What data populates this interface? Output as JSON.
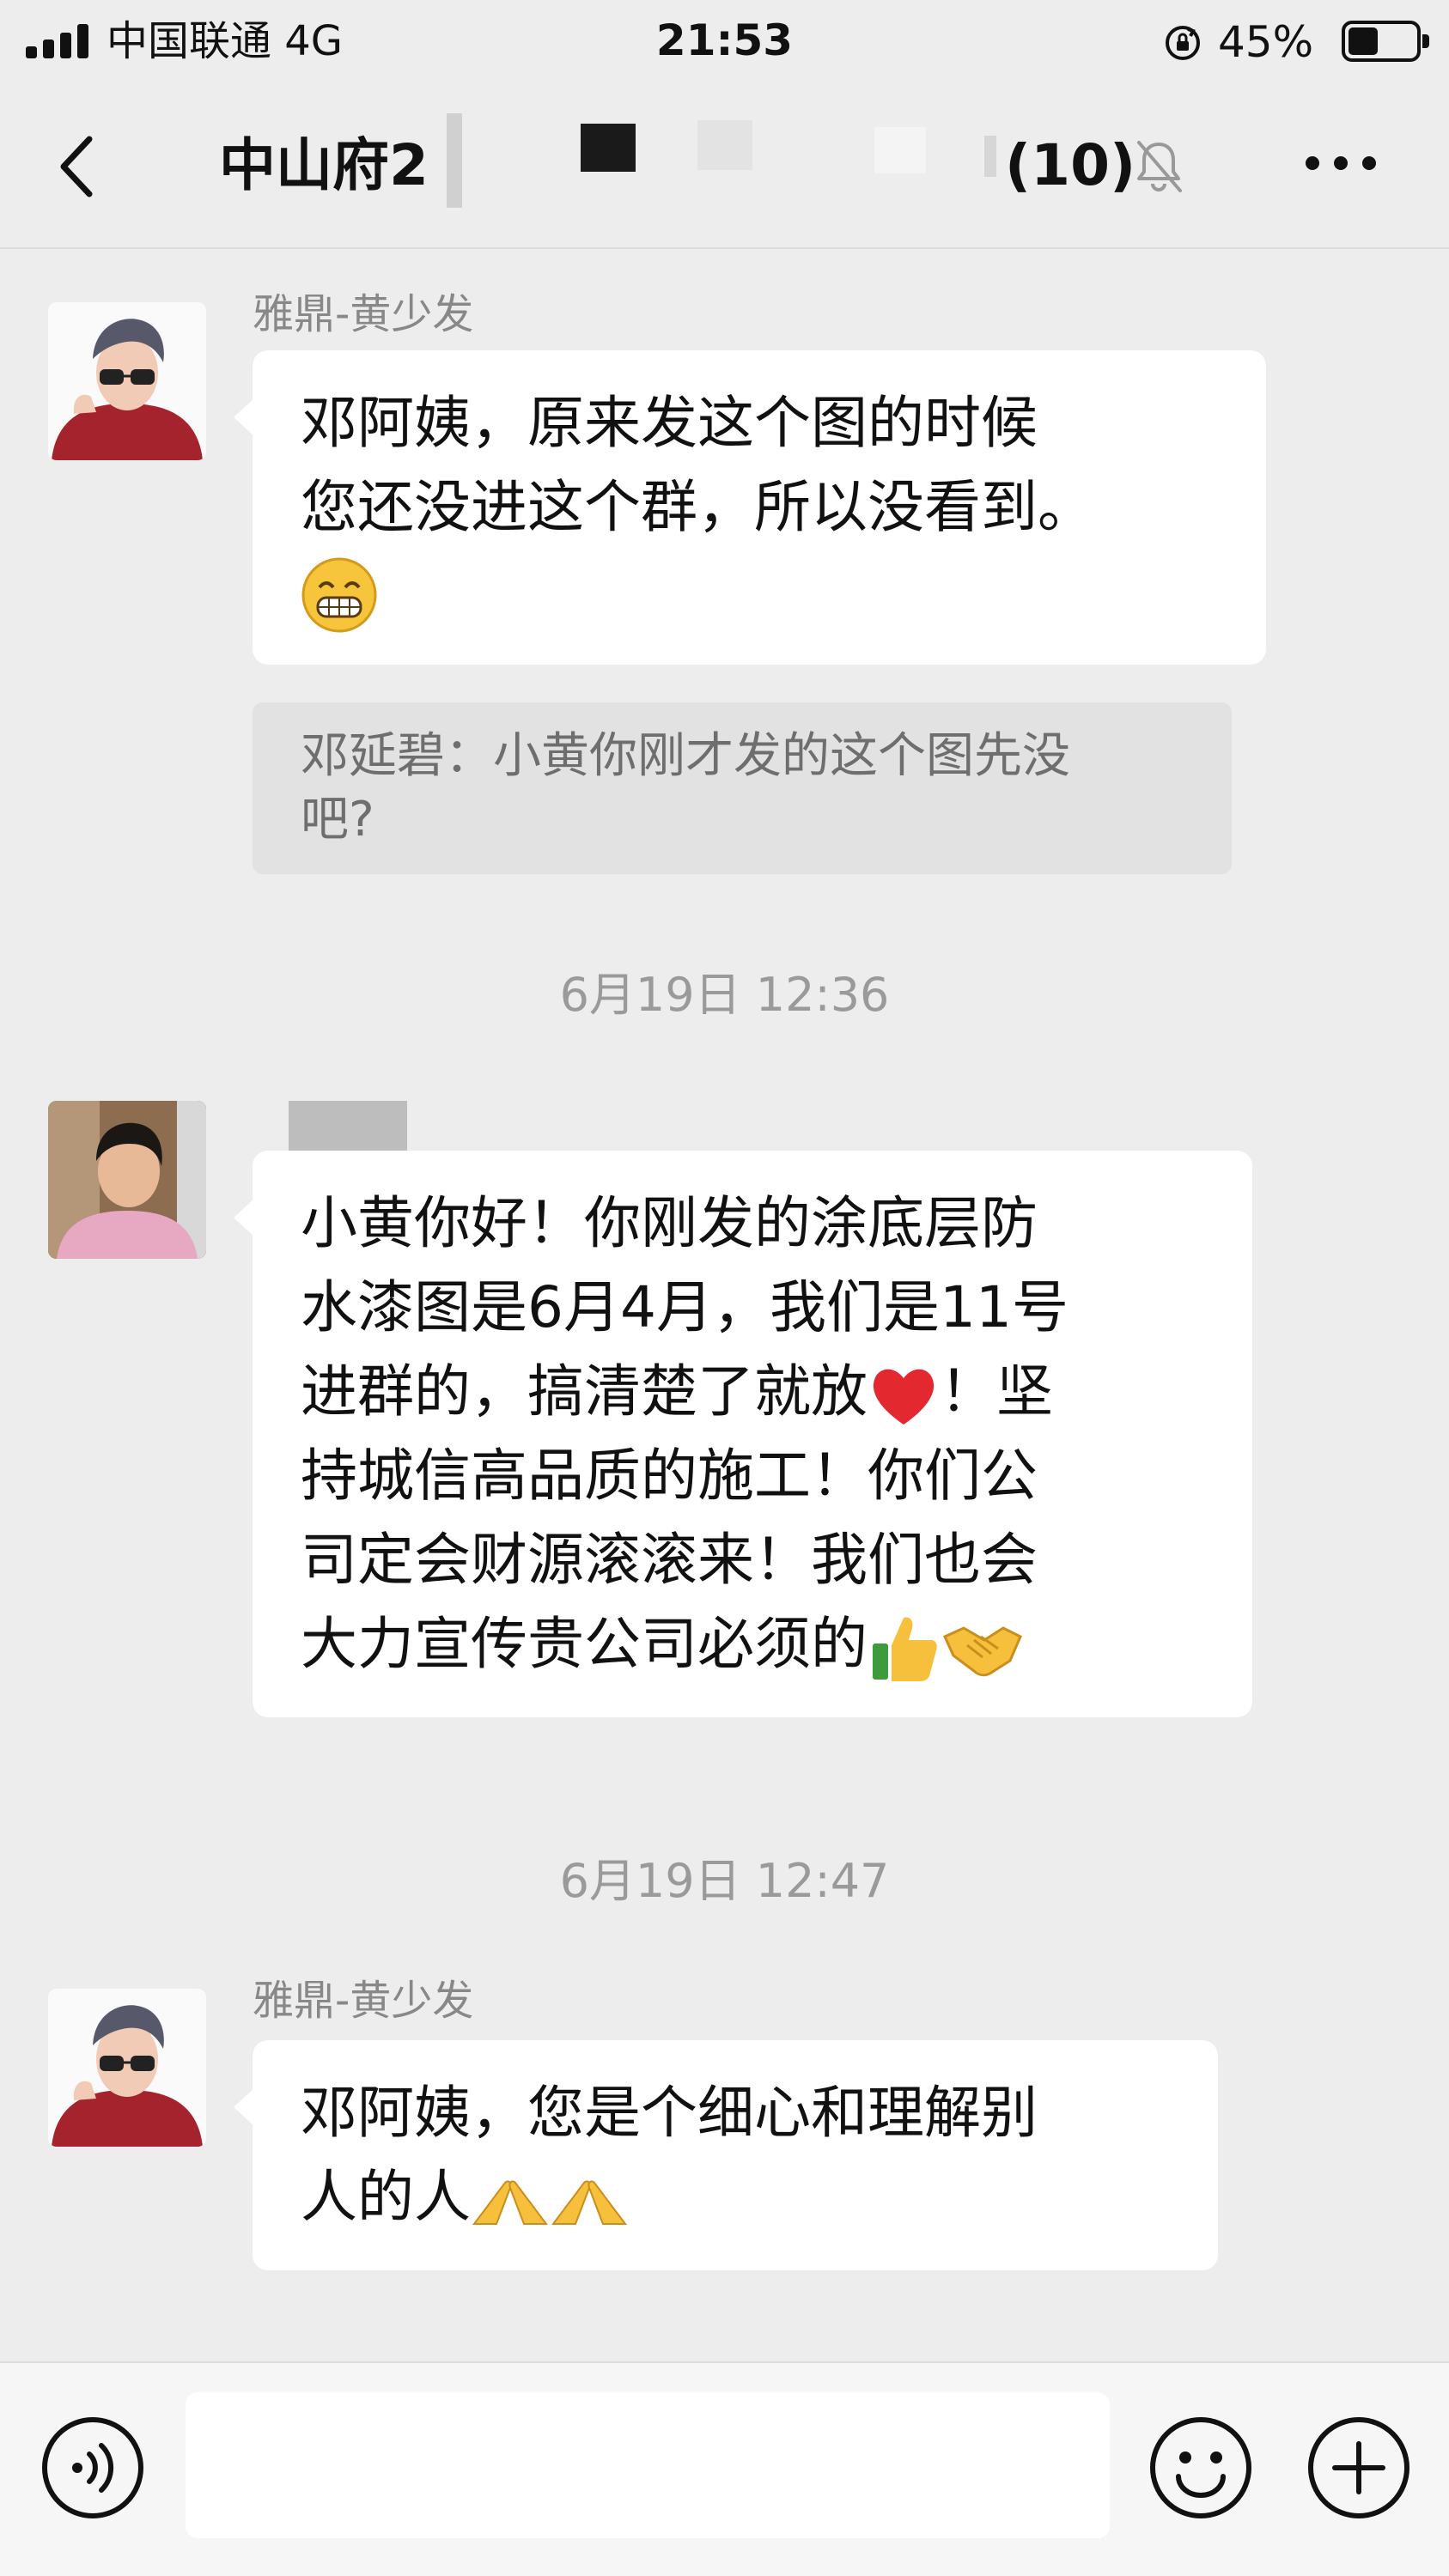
{
  "status_bar": {
    "carrier": "中国联通 4G",
    "time": "21:53",
    "battery_percent": "45%",
    "battery_level": 0.45
  },
  "nav": {
    "title_prefix": "中山府2",
    "member_count": "(10)",
    "back_icon": "chevron-left-icon",
    "mute_icon": "bell-off-icon",
    "more_icon": "ellipsis-icon"
  },
  "messages": [
    {
      "sender": "雅鼎-黄少发",
      "lines": [
        "邓阿姨，原来发这个图的时候",
        "您还没进这个群，所以没看到。"
      ],
      "emoji": "grinning-face",
      "quote_lines": [
        "邓延碧：小黄你刚才发的这个图先没",
        "吧?"
      ]
    },
    {
      "timestamp": "6月19日 12:36"
    },
    {
      "sender": "",
      "lines": [
        "小黄你好！你刚发的涂底层防",
        "水漆图是6月4月，我们是11号",
        "进群的，搞清楚了就放",
        "！坚",
        "持城信高品质的施工！你们公",
        "司定会财源滚滚来！我们也会",
        "大力宣传贵公司必须的"
      ]
    },
    {
      "timestamp": "6月19日 12:47"
    },
    {
      "sender": "雅鼎-黄少发",
      "lines": [
        "邓阿姨，您是个细心和理解别",
        "人的人"
      ]
    }
  ],
  "input_bar": {
    "voice_icon": "voice-icon",
    "emoji_icon": "smiley-icon",
    "plus_icon": "plus-icon"
  }
}
